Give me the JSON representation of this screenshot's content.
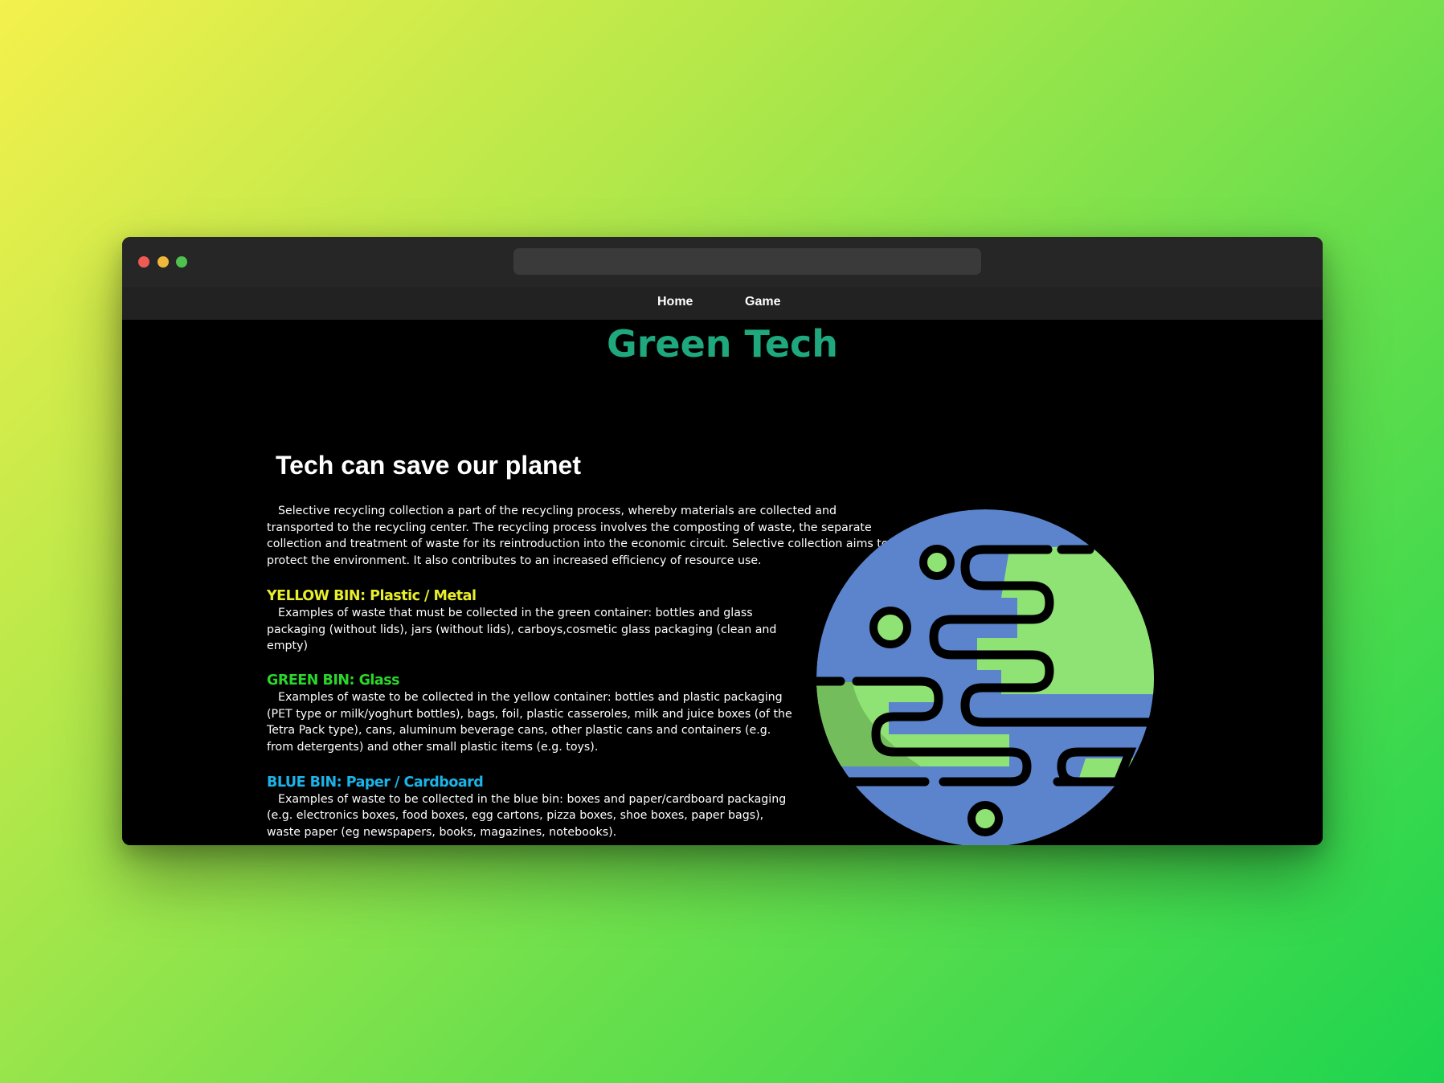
{
  "window": {
    "controls": [
      "close",
      "minimize",
      "maximize"
    ]
  },
  "nav": {
    "items": [
      {
        "label": "Home"
      },
      {
        "label": "Game"
      }
    ]
  },
  "site": {
    "title": "Green Tech",
    "title_color": "#1fa87d"
  },
  "main": {
    "heading": "Tech can save our planet",
    "intro": "Selective recycling collection a part of the recycling process, whereby materials are collected and transported to the recycling center. The recycling process involves the composting of waste, the separate collection and treatment of waste for its reintroduction into the economic circuit. Selective collection aims to protect the environment. It also contributes to an increased efficiency of resource use.",
    "bins": [
      {
        "heading": "YELLOW BIN: Plastic / Metal",
        "color": "#e8ee2a",
        "text": "Examples of waste that must be collected in the green container: bottles and glass packaging (without lids), jars (without lids), carboys,cosmetic glass packaging (clean and empty)"
      },
      {
        "heading": "GREEN BIN: Glass",
        "color": "#2bd62b",
        "text": "Examples of waste to be collected in the yellow container: bottles and plastic packaging (PET type or milk/yoghurt bottles), bags, foil, plastic casseroles, milk and juice boxes (of the Tetra Pack type), cans, aluminum beverage cans, other plastic cans and containers (e.g. from detergents) and other small plastic items (e.g. toys)."
      },
      {
        "heading": "BLUE BIN: Paper / Cardboard",
        "color": "#1ab4e8",
        "text": "Examples of waste to be collected in the blue bin: boxes and paper/cardboard packaging (e.g. electronics boxes, food boxes, egg cartons, pizza boxes, shoe boxes, paper bags), waste paper (eg newspapers, books, magazines, notebooks)."
      }
    ]
  },
  "illustration": {
    "icon": "planet-illustration",
    "colors": {
      "ocean": "#5b84cc",
      "ocean_shadow": "#4a6aad",
      "land": "#8fe374",
      "land_shadow": "#73bd5c",
      "outline": "#000000"
    }
  }
}
